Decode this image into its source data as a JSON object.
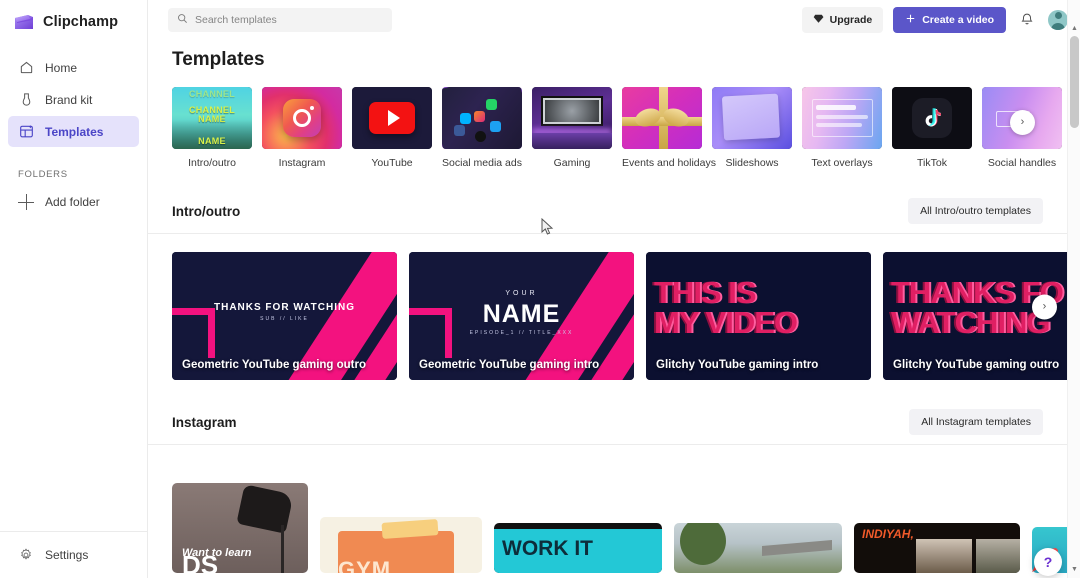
{
  "app": {
    "brand": "Clipchamp"
  },
  "sidebar": {
    "items": [
      {
        "label": "Home",
        "icon": "home-icon",
        "active": false
      },
      {
        "label": "Brand kit",
        "icon": "brand-kit-icon",
        "active": false
      },
      {
        "label": "Templates",
        "icon": "templates-icon",
        "active": true
      }
    ],
    "folders_label": "FOLDERS",
    "add_folder": "Add folder",
    "settings": "Settings"
  },
  "topbar": {
    "search_placeholder": "Search templates",
    "search_value": "",
    "search_icon": "search-icon",
    "upgrade_label": "Upgrade",
    "upgrade_icon": "diamond-icon",
    "create_label": "Create a video",
    "create_icon": "plus-icon",
    "notification_icon": "bell-icon",
    "avatar_icon": "avatar"
  },
  "page": {
    "title": "Templates"
  },
  "categories": {
    "next_label": "›",
    "items": [
      {
        "label": "Intro/outro",
        "art": "t-intro"
      },
      {
        "label": "Instagram",
        "art": "t-insta"
      },
      {
        "label": "YouTube",
        "art": "t-yt"
      },
      {
        "label": "Social media ads",
        "art": "t-sma"
      },
      {
        "label": "Gaming",
        "art": "t-gam"
      },
      {
        "label": "Events and holidays",
        "art": "t-ev"
      },
      {
        "label": "Slideshows",
        "art": "t-ss"
      },
      {
        "label": "Text overlays",
        "art": "t-to"
      },
      {
        "label": "TikTok",
        "art": "t-tt"
      },
      {
        "label": "Social handles",
        "art": "t-sh"
      }
    ]
  },
  "sections": [
    {
      "title": "Intro/outro",
      "all_button": "All Intro/outro templates",
      "next_label": "›",
      "cards": [
        {
          "title": "Geometric YouTube gaming outro",
          "art": "geo",
          "headline": "THANKS FOR WATCHING",
          "sub": "SUB  //  LIKE",
          "eyebrow": ""
        },
        {
          "title": "Geometric YouTube gaming intro",
          "art": "geo",
          "headline": "NAME",
          "sub": "EPISODE_1   //   TITLE_XXX",
          "eyebrow": "YOUR"
        },
        {
          "title": "Glitchy YouTube gaming intro",
          "art": "glitch",
          "line1": "THIS IS",
          "line2": "MY VIDEO"
        },
        {
          "title": "Glitchy YouTube gaming outro",
          "art": "glitch",
          "line1": "THANKS FO",
          "line2": "WATCHING"
        }
      ]
    },
    {
      "title": "Instagram",
      "all_button": "All Instagram templates",
      "cards": [
        {
          "art": "igc1",
          "text": "Want to learn",
          "text2": "DS"
        },
        {
          "art": "igc2",
          "text": "GYM"
        },
        {
          "art": "igc3",
          "text": "WORK IT"
        },
        {
          "art": "igc4",
          "text": ""
        },
        {
          "art": "igc5",
          "text": "INDIYAH,"
        },
        {
          "art": "igc6",
          "text": ""
        }
      ]
    }
  ],
  "help": {
    "icon": "help-question-icon",
    "label": "?"
  },
  "scrollbar": {
    "up": "▲",
    "down": "▼"
  },
  "colors": {
    "accent": "#5b56c9",
    "active_nav_bg": "#e5e2fb",
    "active_nav_text": "#4b45c7",
    "pink": "#f3127f",
    "card_bg": "#14173a"
  }
}
